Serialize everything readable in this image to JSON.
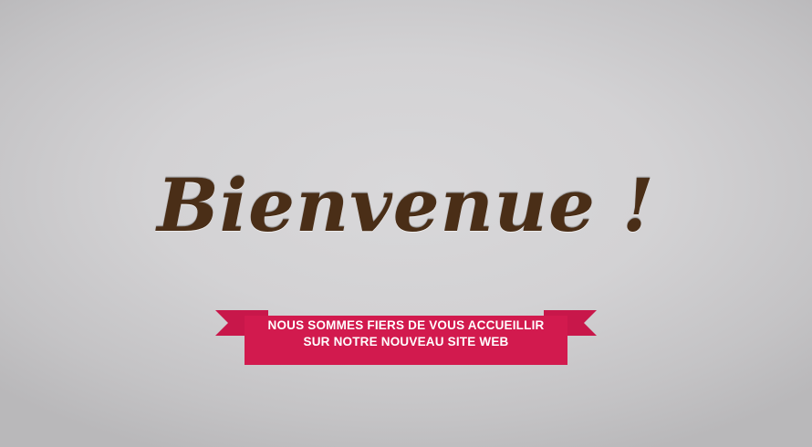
{
  "welcome": {
    "headline": "Bienvenue !",
    "banner_line_1": "NOUS SOMMES FIERS DE VOUS ACCUEILLIR",
    "banner_line_2": "SUR NOTRE NOUVEAU SITE WEB"
  },
  "colors": {
    "headline": "#4a2e17",
    "ribbon": "#d21a4e",
    "ribbon_fold": "#8f0f33",
    "background": "#d3d2d4"
  }
}
